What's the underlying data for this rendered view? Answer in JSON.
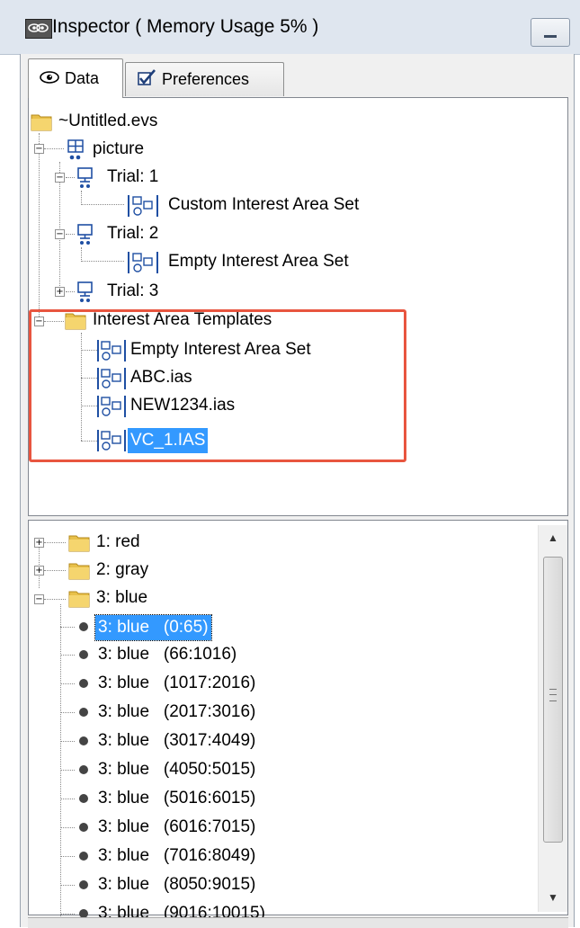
{
  "window": {
    "title": "Inspector ( Memory Usage 5% )",
    "icon": "eye-app-icon",
    "minimize_icon": "minimize-icon"
  },
  "tabs": [
    {
      "label": "Data",
      "icon": "eye-icon",
      "active": true
    },
    {
      "label": "Preferences",
      "icon": "checkbox-icon",
      "active": false
    }
  ],
  "data_tree": {
    "root": "~Untitled.evs",
    "picture": "picture",
    "trial1": "Trial: 1",
    "trial1_child": "Custom Interest Area Set",
    "trial2": "Trial: 2",
    "trial2_child": "Empty Interest Area Set",
    "trial3": "Trial: 3",
    "templates": "Interest Area Templates",
    "template_items": [
      "Empty Interest Area Set",
      "ABC.ias",
      "NEW1234.ias",
      "VC_1.IAS"
    ],
    "selected": "VC_1.IAS"
  },
  "property_tree": {
    "groups": [
      "1: red",
      "2: gray",
      "3: blue"
    ],
    "items": [
      "3: blue   (0:65)",
      "3: blue   (66:1016)",
      "3: blue   (1017:2016)",
      "3: blue   (2017:3016)",
      "3: blue   (3017:4049)",
      "3: blue   (4050:5015)",
      "3: blue   (5016:6015)",
      "3: blue   (6016:7015)",
      "3: blue   (7016:8049)",
      "3: blue   (8050:9015)",
      "3: blue   (9016:10015)"
    ],
    "selected": "3: blue   (0:65)"
  },
  "colors": {
    "selection": "#3399ff",
    "highlight_box": "#e8553f"
  }
}
